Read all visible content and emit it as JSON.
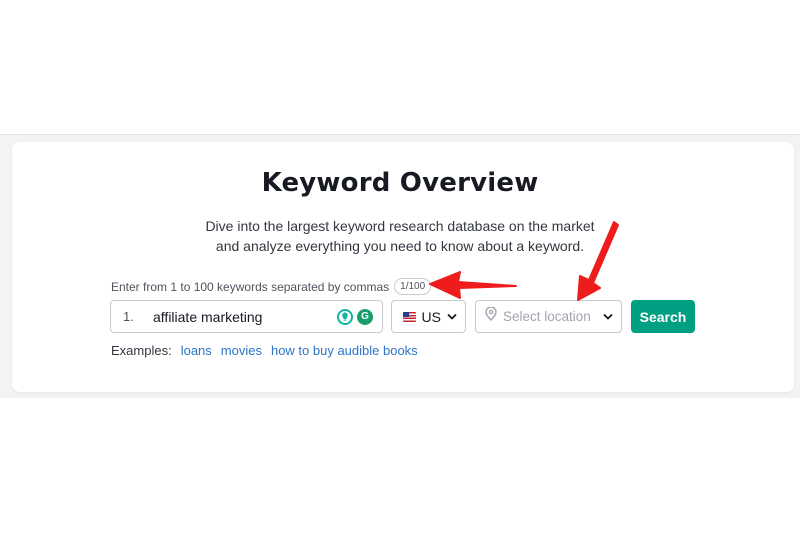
{
  "page": {
    "title": "Keyword Overview",
    "subtitle_line1": "Dive into the largest keyword research database on the market",
    "subtitle_line2": "and analyze everything you need to know about a keyword."
  },
  "form": {
    "hint": "Enter from 1 to 100 keywords separated by commas",
    "counter": "1/100",
    "keyword_number": "1.",
    "keyword_value": "affiliate marketing",
    "country": "US",
    "location_placeholder": "Select location",
    "search_label": "Search"
  },
  "examples": {
    "label": "Examples:",
    "items": [
      "loans",
      "movies",
      "how to buy audible books"
    ]
  },
  "colors": {
    "accent": "#009f81",
    "link": "#2d75c9",
    "annotation_arrow": "#ee1c1c"
  },
  "icons": {
    "flag": "us-flag-icon",
    "location": "map-pin-icon",
    "dropdown": "chevron-down-icon",
    "extension_1": "bulb-icon",
    "extension_2": "grammarly-icon"
  }
}
